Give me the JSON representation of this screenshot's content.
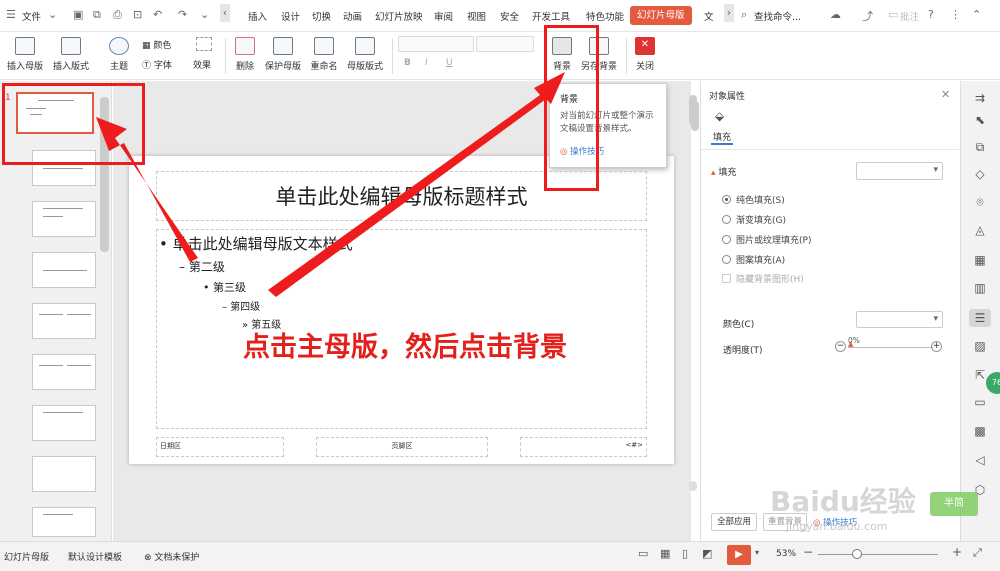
{
  "menubar": {
    "file_label": "文件",
    "items": [
      "插入",
      "设计",
      "切换",
      "动画",
      "幻灯片放映",
      "审阅",
      "视图",
      "安全",
      "开发工具",
      "特色功能",
      "幻灯片母版",
      "文"
    ],
    "search_label": "查找命令...",
    "right_label": "批注"
  },
  "ribbon": {
    "insert_master": "插入母版",
    "insert_layout": "插入版式",
    "theme": "主题",
    "color": "颜色",
    "font": "字体",
    "effect": "效果",
    "delete": "删除",
    "protect_master": "保护母版",
    "rename": "重命名",
    "master_layout": "母版版式",
    "background": "背景",
    "save_background": "另存背景",
    "close": "关闭",
    "bold": "B",
    "italic": "I",
    "underline": "U"
  },
  "tooltip": {
    "title": "背景",
    "desc": "对当前幻灯片或整个演示文稿设置背景样式。",
    "tips": "操作技巧"
  },
  "thumbs": {
    "first_number": "1"
  },
  "slide": {
    "title": "单击此处编辑母版标题样式",
    "level1": "单击此处编辑母版文本样式",
    "level2": "第二级",
    "level3": "第三级",
    "level4": "第四级",
    "level5": "第五级",
    "date": "日期区",
    "footer": "页脚区",
    "number": "<#>"
  },
  "annotation": "点击主母版，然后点击背景",
  "panel": {
    "header": "对象属性",
    "tab": "填充",
    "section": "填充",
    "options": [
      "纯色填充(S)",
      "渐变填充(G)",
      "图片或纹理填充(P)",
      "图案填充(A)",
      "隐藏背景图形(H)"
    ],
    "selected_index": 0,
    "color_label": "颜色(C)",
    "transparency_label": "透明度(T)",
    "transparency_value": "0%",
    "apply_all": "全部应用",
    "reset": "重置背景",
    "tips": "操作技巧"
  },
  "badge": "76",
  "status": {
    "view": "幻灯片母版",
    "template": "默认设计模板",
    "protect": "文档未保护",
    "zoom": "53%"
  },
  "watermark": {
    "line1": "Baidu经验",
    "line2": "jingyan.baidu.com",
    "tag": "半简"
  },
  "colors": {
    "accent": "#e35a3e",
    "red_annotation": "#ee1c1c"
  }
}
